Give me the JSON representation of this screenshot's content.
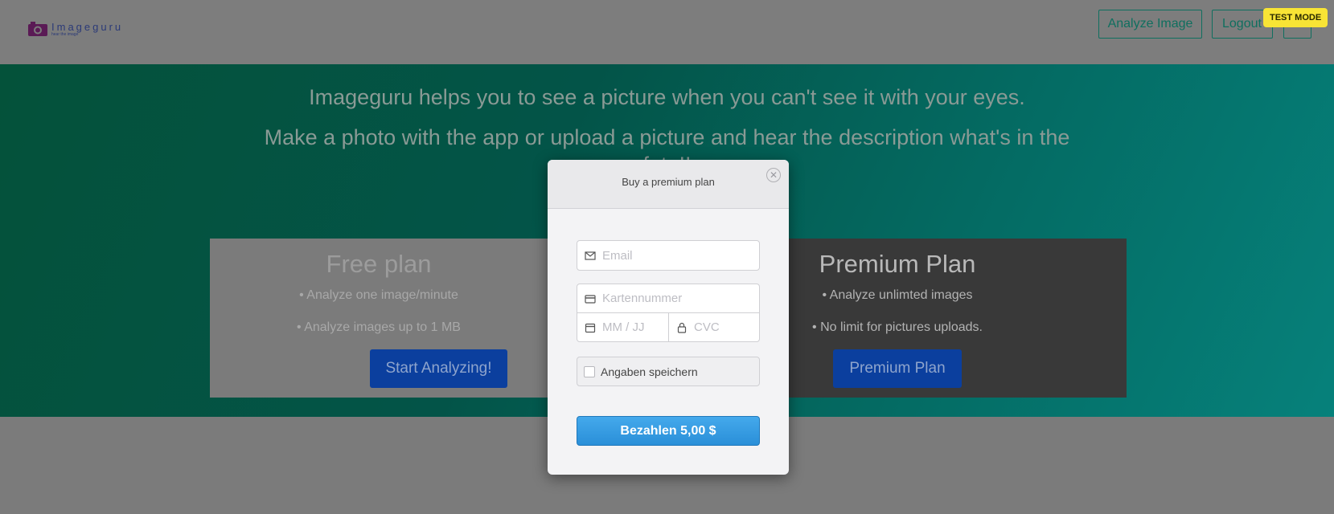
{
  "header": {
    "logo_name": "Imageguru",
    "logo_tagline": "hear the image",
    "analyze_label": "Analyze Image",
    "logout_label": "Logout",
    "test_mode_label": "TEST MODE"
  },
  "hero": {
    "line1": "Imageguru helps you to see a picture when you can't see it with your eyes.",
    "line2": "Make a photo with the app or upload a picture and hear the description what's in the foto!!"
  },
  "plans": {
    "free": {
      "title": "Free plan",
      "items": [
        "• Analyze one image/minute",
        "• Analyze images up to 1 MB"
      ],
      "button": "Start Analyzing!"
    },
    "premium": {
      "title": "Premium Plan",
      "items": [
        "• Analyze unlimted images",
        "• No limit for pictures uploads."
      ],
      "button": "Premium Plan"
    }
  },
  "modal": {
    "title": "Buy a premium plan",
    "close_symbol": "✕",
    "email_placeholder": "Email",
    "card_placeholder": "Kartennummer",
    "expiry_placeholder": "MM / JJ",
    "cvc_placeholder": "CVC",
    "remember_label": "Angaben speichern",
    "pay_label": "Bezahlen 5,00 $"
  },
  "colors": {
    "accent": "#0f6f5f",
    "pay_button": "#2a8fd8",
    "test_mode_badge": "#f8e435"
  }
}
